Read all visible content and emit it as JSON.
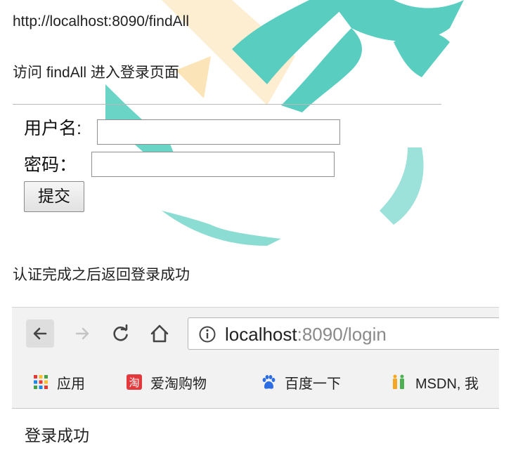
{
  "notes": {
    "url_line": "http://localhost:8090/findAll",
    "step1": "访问 findAll 进入登录页面",
    "step2": "认证完成之后返回登录成功"
  },
  "login_form": {
    "username_label": "用户名:",
    "password_label": "密码：",
    "username_value": "",
    "password_value": "",
    "submit_label": "提交"
  },
  "browser": {
    "address_host": "localhost",
    "address_path": ":8090/login",
    "bookmarks": [
      {
        "label": "应用",
        "icon": "apps-grid-icon"
      },
      {
        "label": "爱淘购物",
        "icon": "taobao-icon"
      },
      {
        "label": "百度一下",
        "icon": "baidu-paw-icon"
      },
      {
        "label": "MSDN, 我",
        "icon": "msdn-icon"
      }
    ]
  },
  "result_text": "登录成功",
  "colors": {
    "watermark_teal": "#3cc6b5",
    "watermark_orange": "#f7b84a",
    "taobao_red": "#e4393c",
    "baidu_blue": "#2b6de5"
  }
}
